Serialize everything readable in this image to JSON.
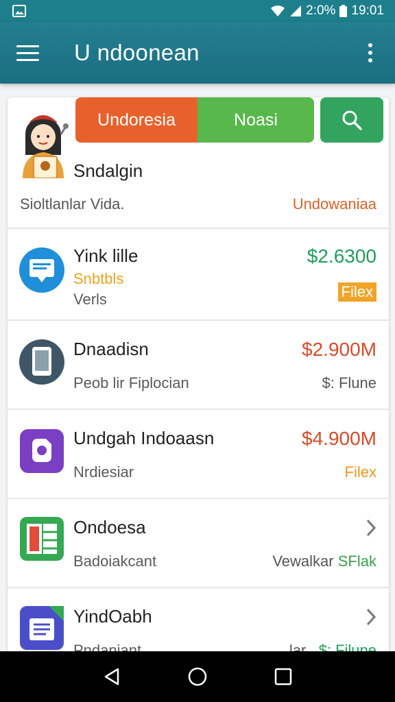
{
  "status_bar": {
    "battery": "2:0%",
    "time": "19:01",
    "icons": [
      "image-icon",
      "wifi-icon",
      "signal-icon",
      "battery-icon"
    ]
  },
  "app_bar": {
    "title": "U ndoonean",
    "icons": [
      "hamburger-menu-icon",
      "overflow-menu-icon"
    ]
  },
  "header": {
    "tab_primary": "Undoresia",
    "tab_secondary": "Noasi",
    "search_icon": "search-icon",
    "name": "Sndalgin",
    "subtitle": "Sioltlanlar Vida.",
    "right_label": "Undowaniaa",
    "colors": {
      "orange": "#e8612c",
      "green": "#58b84c",
      "dark_green": "#33a45f"
    }
  },
  "items": [
    {
      "icon": "monitor-chat-icon",
      "title": "Yink lille",
      "line1": "Snbtbls",
      "line2": "Verls",
      "price": "$2.6300",
      "tag": "Filex"
    },
    {
      "icon": "tablet-icon",
      "title": "Dnaadisn",
      "line1": "Peob lir Fiplocian",
      "price": "$2.900M",
      "tag": "$: Flune"
    },
    {
      "icon": "puzzle-icon",
      "title": "Undgah Indoaasn",
      "line1": "Nrdiesiar",
      "price": "$4.900M",
      "tag": "Filex"
    },
    {
      "icon": "spreadsheet-icon",
      "title": "Ondoesa",
      "line1": "Badoiakcant",
      "tag_prefix": "Vewalkar",
      "tag_suffix": "SFlak",
      "trailing": "chevron-right-icon"
    },
    {
      "icon": "document-icon",
      "title": "YindOabh",
      "line1": "Pndaniant",
      "tag_prefix": "lar",
      "tag": "$: Filune",
      "trailing": "chevron-right-icon"
    }
  ],
  "nav_bar": {
    "icons": [
      "back-icon",
      "home-icon",
      "recents-icon"
    ]
  }
}
